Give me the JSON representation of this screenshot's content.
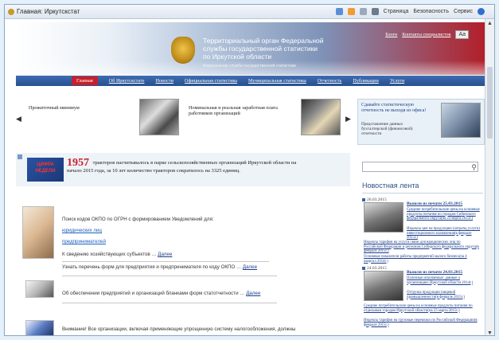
{
  "browser": {
    "tab_title": "Главная: Иркутскстат",
    "tools": {
      "page": "Страница",
      "safety": "Безопасность",
      "service": "Сервис"
    }
  },
  "header": {
    "title_line1": "Территориальный орган Федеральной",
    "title_line2": "службы государственной статистики",
    "title_line3": "по Иркутской области",
    "subtitle": "Федеральная служба государственной статистики",
    "link_blog": "Блоги",
    "link_contacts": "Контакты специалистов",
    "aa": "Aa"
  },
  "nav": {
    "items": [
      "Главная",
      "Об Иркутскстате",
      "Новости",
      "Официальная статистика",
      "Муниципальная статистика",
      "Отчетность",
      "Публикации",
      "Услуги"
    ]
  },
  "carousel": {
    "item1": "Прожиточный минимум",
    "item2_line1": "Номинальная и реальная заработная плата",
    "item2_line2": "работников организаций",
    "prev_arrow": "◀",
    "next_arrow": "▶"
  },
  "promo": {
    "title_line1": "Сдавайте статистическую",
    "title_line2": "отчетность не выходя из офиса!",
    "sub_line1": "Представление данных",
    "sub_line2": "бухгалтерской (финансовой)",
    "sub_line3": "отчетности"
  },
  "stat": {
    "banner": "ЦИФРА НЕДЕЛИ",
    "year": "1957",
    "line1": "тракторов насчитывалось в парке сельскохозяйственных организаций Иркутской области на",
    "line2": "начало 2015 года, за 10 лет количество тракторов сократилось на 3325 единиц."
  },
  "search": {
    "placeholder": ""
  },
  "news": {
    "heading": "Новостная лента",
    "items": [
      {
        "date": "26.03.2015",
        "title_line1": "Вышли из печати 25.03.2015",
        "link1": "Средние потребительские цены на основные продукты питания по городам Сибирского федерального округа(на 23 марта 2015г.)",
        "link2": "Индексы цен на продукцию (затраты,услуги) инвестиционного назначения(в феврале 2015г.)",
        "link3": "Индексы тарифов на услуги связи для юридических лиц по Российской Федерации и регионам Сибирского федерального округа(в феврале 2015г.)",
        "link4": "Основные показатели работы предприятий малого бизнеса(за 4 квартал 2014г.)"
      },
      {
        "date": "24.03.2015",
        "title_line1": "Вышли из печати 24.03.2015",
        "link1": "Полезные ископаемые: данные о организациях Иркутской области 2014г.)",
        "link2": "Отгрузка продукции пищевой промышленности(в феврале 2015г.)",
        "link3": "Средние потребительские цены на основные продукты питания по отдельным городам Иркутской области(на 23 марта 2015г.)",
        "link4": "Индексы тарифов на грузовые перевозки по Российской Федерации(в феврале 2015г.)"
      }
    ]
  },
  "okpo": {
    "intro": "Поиск кодов ОКПО по ОГРН с формированием Уведомлений для:",
    "link1": "юридических лиц",
    "link2": "предпринимателей",
    "other_prefix": "К сведению хозяйствующих субъектов",
    "more1": "Далее",
    "forms_text": "Узнать перечень форм для предприятия и предпринимателя по коду ОКПО",
    "more2": "Далее"
  },
  "blanks": {
    "text": "Об обеспечении предприятий и организаций бланками форм статотчетности",
    "more": "Далее"
  },
  "warning": {
    "text": "Внимание! Все организации, включая применяющие упрощенную систему налогообложения, должны"
  },
  "scroll": {
    "up": "▲",
    "down": "▼"
  }
}
